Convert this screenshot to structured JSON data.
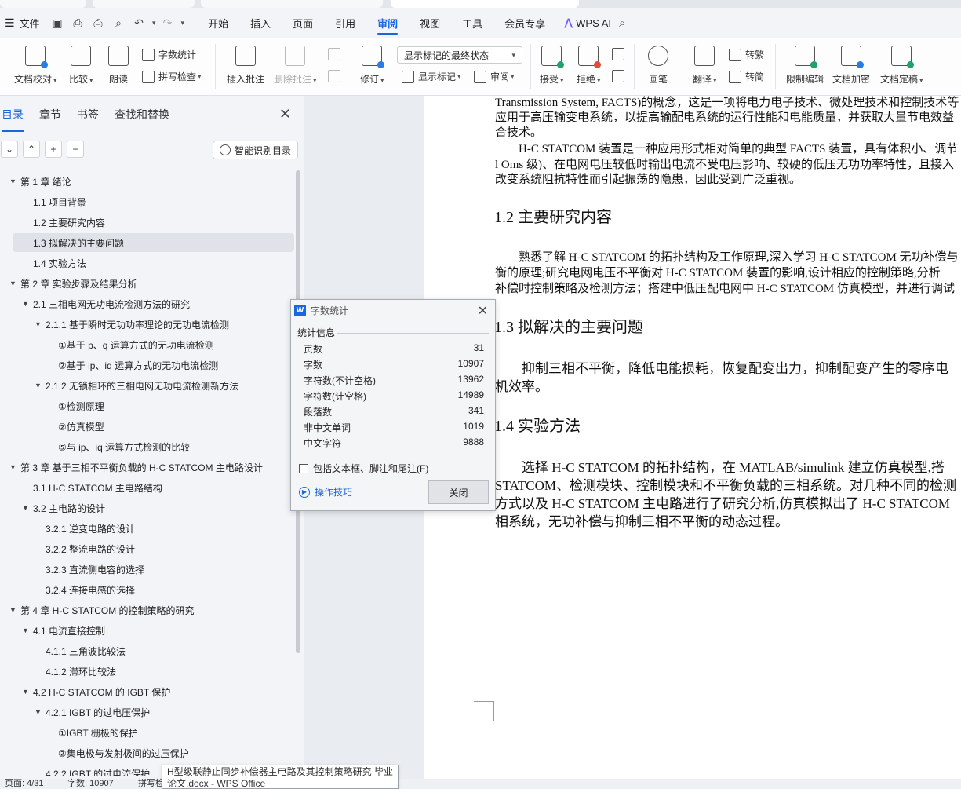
{
  "menubar": {
    "file_label": "文件",
    "tabs": [
      "开始",
      "插入",
      "页面",
      "引用",
      "审阅",
      "视图",
      "工具",
      "会员专享"
    ],
    "active_tab": "审阅",
    "ai_label": "WPS AI"
  },
  "ribbon": {
    "doc_proofread": "文档校对",
    "compare": "比较",
    "read_aloud": "朗读",
    "word_count": "字数统计",
    "spell_check": "拼写检查",
    "insert_comment": "插入批注",
    "delete_comment": "删除批注",
    "track_changes": "修订",
    "markup_state": "显示标记的最终状态",
    "show_markup": "显示标记",
    "review": "审阅",
    "accept": "接受",
    "reject": "拒绝",
    "pen": "画笔",
    "translate": "翻译",
    "to_traditional": "转繁",
    "to_simplified": "转简",
    "restrict_edit": "限制编辑",
    "encrypt": "文档加密",
    "finalize": "文档定稿"
  },
  "nav": {
    "tabs": [
      "目录",
      "章节",
      "书签",
      "查找和替换"
    ],
    "smart_toc": "智能识别目录",
    "toc": [
      {
        "label": "第 1 章  绪论",
        "level": 0,
        "arrow": true
      },
      {
        "label": "1.1 项目背景",
        "level": 1,
        "arrow": false
      },
      {
        "label": "1.2 主要研究内容",
        "level": 1,
        "arrow": false
      },
      {
        "label": "1.3 拟解决的主要问题",
        "level": 1,
        "arrow": false,
        "selected": true
      },
      {
        "label": "1.4  实验方法",
        "level": 1,
        "arrow": false
      },
      {
        "label": "第 2 章  实验步骤及结果分析",
        "level": 0,
        "arrow": true
      },
      {
        "label": "2.1 三相电网无功电流检测方法的研究",
        "level": 1,
        "arrow": true
      },
      {
        "label": "2.1.1 基于瞬时无功功率理论的无功电流检测",
        "level": 2,
        "arrow": true
      },
      {
        "label": "①基于 p、q 运算方式的无功电流检测",
        "level": 3,
        "arrow": false
      },
      {
        "label": "②基于 ip、iq 运算方式的无功电流检测",
        "level": 3,
        "arrow": false
      },
      {
        "label": "2.1.2 无锁相环的三相电网无功电流检测新方法",
        "level": 2,
        "arrow": true
      },
      {
        "label": "①检测原理",
        "level": 3,
        "arrow": false
      },
      {
        "label": "②仿真模型",
        "level": 3,
        "arrow": false
      },
      {
        "label": "⑤与 ip、iq 运算方式检测的比较",
        "level": 3,
        "arrow": false
      },
      {
        "label": "第 3 章  基于三相不平衡负载的 H-C STATCOM 主电路设计",
        "level": 0,
        "arrow": true
      },
      {
        "label": "3.1 H-C STATCOM 主电路结构",
        "level": 1,
        "arrow": false
      },
      {
        "label": "3.2 主电路的设计",
        "level": 1,
        "arrow": true
      },
      {
        "label": "3.2.1 逆变电路的设计",
        "level": 2,
        "arrow": false
      },
      {
        "label": "3.2.2 整流电路的设计",
        "level": 2,
        "arrow": false
      },
      {
        "label": "3.2.3 直流侧电容的选择",
        "level": 2,
        "arrow": false
      },
      {
        "label": "3.2.4 连接电感的选择",
        "level": 2,
        "arrow": false
      },
      {
        "label": "第 4 章  H-C STATCOM 的控制策略的研究",
        "level": 0,
        "arrow": true
      },
      {
        "label": "4.1 电流直接控制",
        "level": 1,
        "arrow": true
      },
      {
        "label": "4.1.1 三角波比较法",
        "level": 2,
        "arrow": false
      },
      {
        "label": "4.1.2 滞环比较法",
        "level": 2,
        "arrow": false
      },
      {
        "label": "4.2 H-C STATCOM 的 IGBT 保护",
        "level": 1,
        "arrow": true
      },
      {
        "label": "4.2.1 IGBT 的过电压保护",
        "level": 2,
        "arrow": true
      },
      {
        "label": "①IGBT 栅极的保护",
        "level": 3,
        "arrow": false
      },
      {
        "label": "②集电极与发射极间的过压保护",
        "level": 3,
        "arrow": false
      },
      {
        "label": "4.2.2 IGBT 的过电流保护",
        "level": 2,
        "arrow": false
      }
    ]
  },
  "doc": {
    "lines": [
      "Transmission System, FACTS)的概念，这是一项将电力电子技术、微处理技术和控制技术等",
      "应用于高压输变电系统，以提高输配电系统的运行性能和电能质量，并获取大量节电效益",
      "合技术。",
      "H-C STATCOM 装置是一种应用形式相对简单的典型 FACTS 装置，具有体积小、调节",
      "l Oms 级)、在电网电压较低时输出电流不受电压影响、较硬的低压无功功率特性，且接入",
      "改变系统阻抗特性而引起振荡的隐患，因此受到广泛重视。"
    ],
    "h12": "1.2 主要研究内容",
    "p12": [
      "熟悉了解 H-C STATCOM 的拓扑结构及工作原理,深入学习 H-C STATCOM 无功补偿与",
      "衡的原理;研究电网电压不平衡对 H-C STATCOM 装置的影响,设计相应的控制策略,分析",
      "补偿时控制策略及检测方法；搭建中低压配电网中 H-C STATCOM 仿真模型，并进行调试"
    ],
    "h13": "1.3 拟解决的主要问题",
    "p13": [
      "抑制三相不平衡，降低电能损耗，恢复配变出力，抑制配变产生的零序电",
      "机效率。"
    ],
    "h14": "1.4  实验方法",
    "p14": [
      "选择 H-C STATCOM 的拓扑结构，在 MATLAB/simulink 建立仿真模型,搭",
      "STATCOM、检测模块、控制模块和不平衡负载的三相系统。对几种不同的检测",
      "方式以及 H-C STATCOM 主电路进行了研究分析,仿真模拟出了 H-C STATCOM",
      "相系统，无功补偿与抑制三相不平衡的动态过程。"
    ]
  },
  "dialog": {
    "title": "字数统计",
    "section": "统计信息",
    "stats": [
      {
        "label": "页数",
        "value": "31"
      },
      {
        "label": "字数",
        "value": "10907"
      },
      {
        "label": "字符数(不计空格)",
        "value": "13962"
      },
      {
        "label": "字符数(计空格)",
        "value": "14989"
      },
      {
        "label": "段落数",
        "value": "341"
      },
      {
        "label": "非中文单词",
        "value": "1019"
      },
      {
        "label": "中文字符",
        "value": "9888"
      }
    ],
    "include_label": "包括文本框、脚注和尾注(F)",
    "tips_label": "操作技巧",
    "close_label": "关闭"
  },
  "statusbar": {
    "page": "页面: 4/31",
    "words": "字数: 10907",
    "spell": "拼写检"
  },
  "tooltip": {
    "line1": "H型级联静止同步补偿器主电路及其控制策略研究 毕业",
    "line2": "论文.docx - WPS Office"
  },
  "colors": {
    "accent": "#1a66e0"
  }
}
